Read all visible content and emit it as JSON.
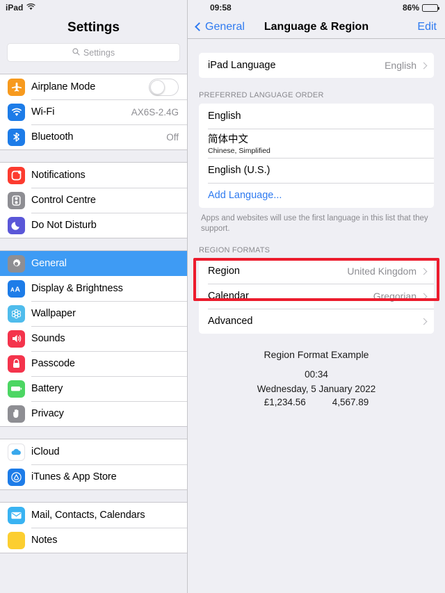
{
  "left": {
    "statusbar": {
      "device": "iPad",
      "wifi_icon": "wifi-icon"
    },
    "title": "Settings",
    "search": {
      "placeholder": "Settings",
      "icon": "search-icon"
    },
    "groups": [
      {
        "items": [
          {
            "label": "Airplane Mode",
            "icon": "airplane-icon",
            "color": "#F79A1E",
            "control": "toggle",
            "toggle_on": false
          },
          {
            "label": "Wi-Fi",
            "icon": "wifi-icon",
            "color": "#1D7CE8",
            "value": "AX6S-2.4G"
          },
          {
            "label": "Bluetooth",
            "icon": "bluetooth-icon",
            "color": "#1D7CE8",
            "value": "Off"
          }
        ]
      },
      {
        "items": [
          {
            "label": "Notifications",
            "icon": "notifications-icon",
            "color": "#FC3B2F"
          },
          {
            "label": "Control Centre",
            "icon": "control-centre-icon",
            "color": "#8E8E93"
          },
          {
            "label": "Do Not Disturb",
            "icon": "moon-icon",
            "color": "#5A57D8"
          }
        ]
      },
      {
        "items": [
          {
            "label": "General",
            "icon": "gear-icon",
            "color": "#8E8E93",
            "selected": true
          },
          {
            "label": "Display & Brightness",
            "icon": "text-size-icon",
            "color": "#1D7CE8"
          },
          {
            "label": "Wallpaper",
            "icon": "wallpaper-icon",
            "color": "#4FBCEC"
          },
          {
            "label": "Sounds",
            "icon": "sounds-icon",
            "color": "#F4344C"
          },
          {
            "label": "Passcode",
            "icon": "lock-icon",
            "color": "#F4344C"
          },
          {
            "label": "Battery",
            "icon": "battery-icon",
            "color": "#4CD663"
          },
          {
            "label": "Privacy",
            "icon": "hand-icon",
            "color": "#8E8E93"
          }
        ]
      },
      {
        "items": [
          {
            "label": "iCloud",
            "icon": "icloud-icon",
            "color": "#FFFFFF"
          },
          {
            "label": "iTunes & App Store",
            "icon": "app-store-icon",
            "color": "#1D7CE8"
          }
        ]
      },
      {
        "items": [
          {
            "label": "Mail, Contacts, Calendars",
            "icon": "mail-icon",
            "color": "#39B3F2"
          },
          {
            "label": "Notes",
            "icon": "notes-icon",
            "color": "#FCCE30"
          }
        ]
      }
    ]
  },
  "right": {
    "statusbar": {
      "time": "09:58",
      "battery_text": "86%",
      "battery_icon": "battery-icon"
    },
    "navbar": {
      "back_label": "General",
      "back_icon": "chevron-left-icon",
      "title": "Language & Region",
      "edit_label": "Edit"
    },
    "ipad_language": {
      "label": "iPad Language",
      "value": "English",
      "chevron": "chevron-right-icon"
    },
    "preferred_header": "PREFERRED LANGUAGE ORDER",
    "languages": [
      {
        "label": "English",
        "sub": ""
      },
      {
        "label": "简体中文",
        "sub": "Chinese, Simplified"
      },
      {
        "label": "English (U.S.)",
        "sub": ""
      }
    ],
    "add_language": "Add Language...",
    "languages_footnote": "Apps and websites will use the first language in this list that they support.",
    "region_header": "REGION FORMATS",
    "region_rows": [
      {
        "label": "Region",
        "value": "United Kingdom",
        "chevron": "chevron-right-icon"
      },
      {
        "label": "Calendar",
        "value": "Gregorian",
        "chevron": "chevron-right-icon"
      },
      {
        "label": "Advanced",
        "value": "",
        "chevron": "chevron-right-icon"
      }
    ],
    "example": {
      "title": "Region Format Example",
      "time": "00:34",
      "date": "Wednesday, 5 January 2022",
      "currency": "£1,234.56",
      "number": "4,567.89"
    },
    "highlight_color": "#EC1C2D"
  }
}
